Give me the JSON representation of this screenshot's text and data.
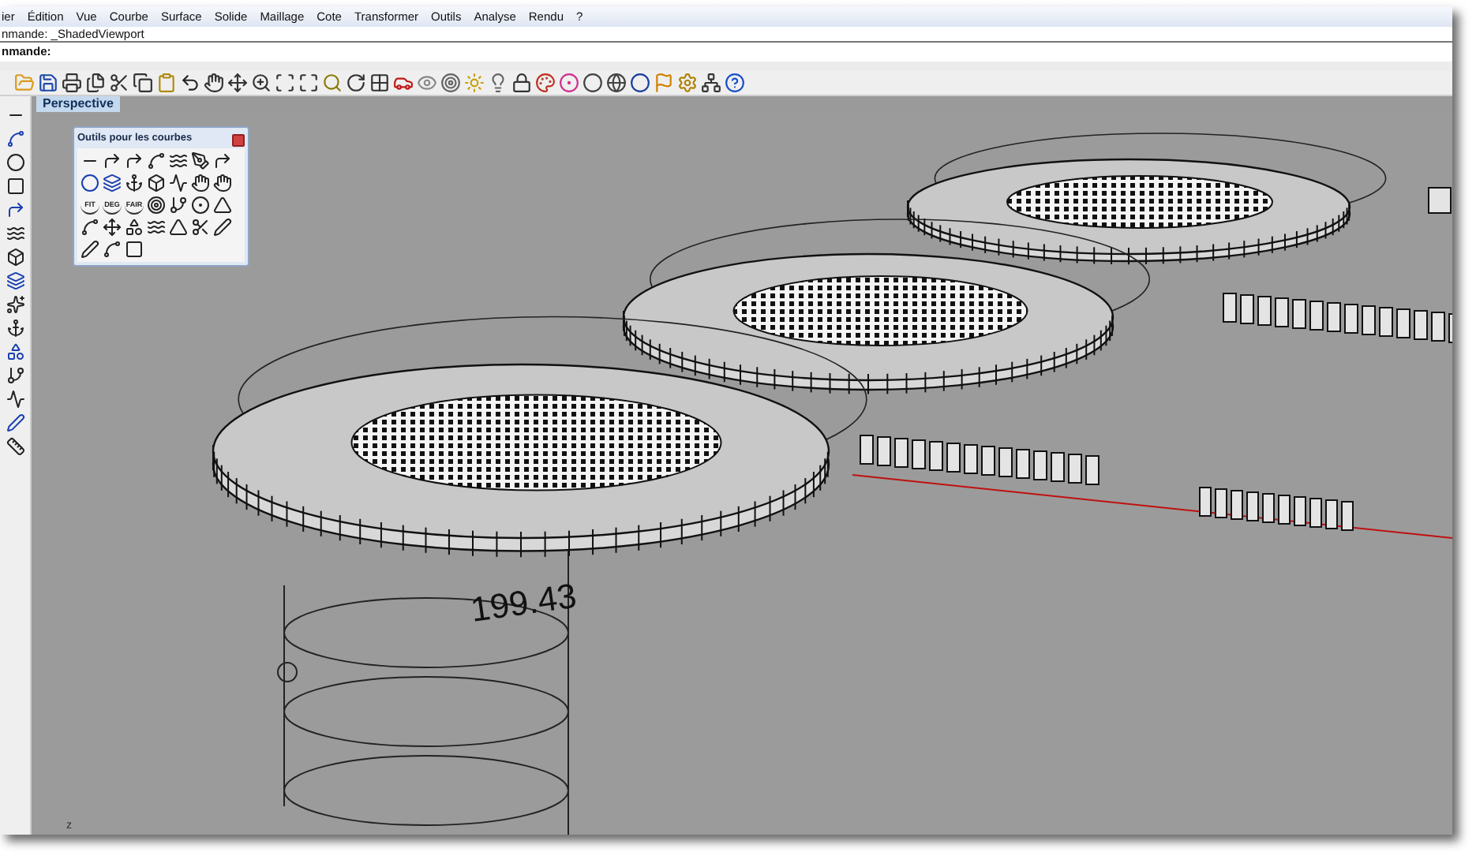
{
  "menu_bar": [
    "ier",
    "Édition",
    "Vue",
    "Courbe",
    "Surface",
    "Solide",
    "Maillage",
    "Cote",
    "Transformer",
    "Outils",
    "Analyse",
    "Rendu",
    "?"
  ],
  "command_history": "nmande: _ShadedViewport",
  "command_prompt": "nmande:",
  "viewport": {
    "tab": {
      "label": "Perspective",
      "selected": true
    },
    "dimension": "199.43",
    "axis_label": "z"
  },
  "palette": {
    "title": "Outils pour les courbes",
    "text_tools": [
      "FIT",
      "DEG",
      "FAIR"
    ]
  }
}
